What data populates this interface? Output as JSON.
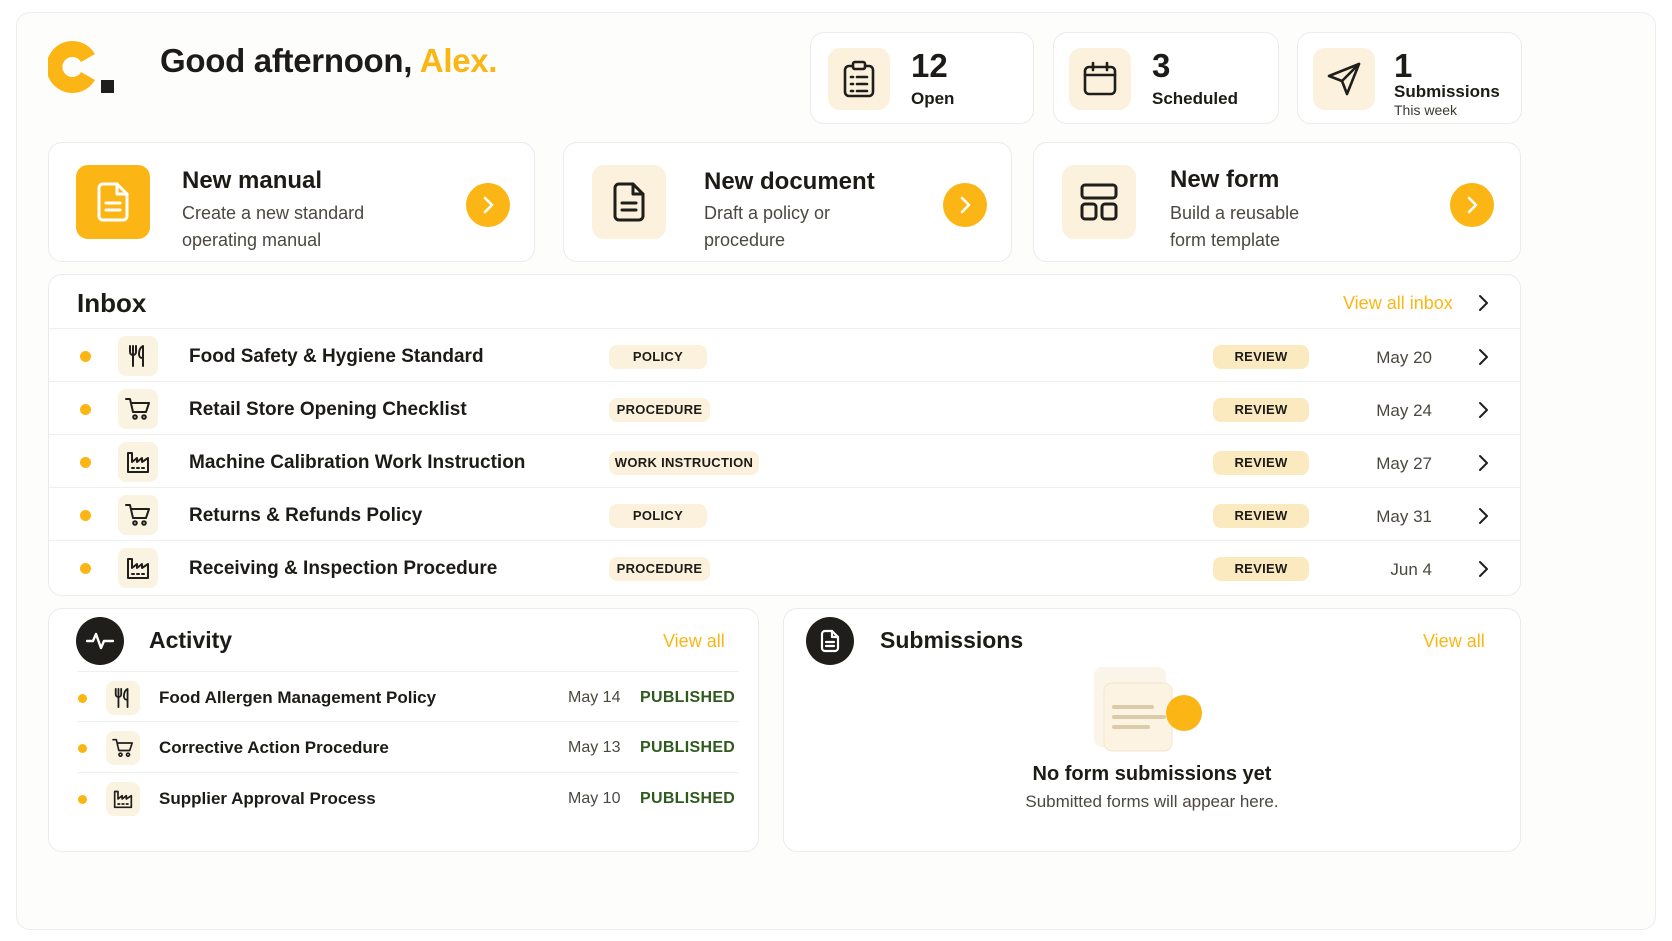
{
  "header": {
    "greeting": "Good afternoon,",
    "user_name": "Alex."
  },
  "stats": [
    {
      "value": "12",
      "label": "Open",
      "sublabel": "",
      "icon": "clipboard-icon"
    },
    {
      "value": "3",
      "label": "Scheduled",
      "sublabel": "",
      "icon": "calendar-icon"
    },
    {
      "value": "1",
      "label": "Submissions",
      "sublabel": "This week",
      "icon": "send-icon"
    }
  ],
  "quick_actions": [
    {
      "title": "New manual",
      "desc": "Create a new standard operating manual",
      "icon": "document-icon"
    },
    {
      "title": "New document",
      "desc": "Draft a policy or procedure",
      "icon": "document-icon"
    },
    {
      "title": "New form",
      "desc": "Build a reusable form template",
      "icon": "layout-icon"
    }
  ],
  "inbox": {
    "title": "Inbox",
    "view_all": "View all inbox",
    "items": [
      {
        "title": "Food Safety & Hygiene Standard",
        "tag": "POLICY",
        "status": "REVIEW",
        "date": "May 20",
        "icon": "utensils-icon"
      },
      {
        "title": "Retail Store Opening Checklist",
        "tag": "PROCEDURE",
        "status": "REVIEW",
        "date": "May 24",
        "icon": "cart-icon"
      },
      {
        "title": "Machine Calibration Work Instruction",
        "tag": "WORK INSTRUCTION",
        "status": "REVIEW",
        "date": "May 27",
        "icon": "factory-icon"
      },
      {
        "title": "Returns & Refunds Policy",
        "tag": "POLICY",
        "status": "REVIEW",
        "date": "May 31",
        "icon": "cart-icon"
      },
      {
        "title": "Receiving & Inspection Procedure",
        "tag": "PROCEDURE",
        "status": "REVIEW",
        "date": "Jun 4",
        "icon": "factory-icon"
      }
    ]
  },
  "activity": {
    "title": "Activity",
    "view_all": "View all",
    "items": [
      {
        "title": "Food Allergen Management Policy",
        "date": "May 14",
        "status": "PUBLISHED",
        "icon": "utensils-icon"
      },
      {
        "title": "Corrective Action Procedure",
        "date": "May 13",
        "status": "PUBLISHED",
        "icon": "cart-icon"
      },
      {
        "title": "Supplier Approval Process",
        "date": "May 10",
        "status": "PUBLISHED",
        "icon": "factory-icon"
      }
    ]
  },
  "submissions": {
    "title": "Submissions",
    "view_all": "View all",
    "empty_title": "No form submissions yet",
    "empty_sub": "Submitted forms will appear here."
  },
  "colors": {
    "accent": "#fbb615",
    "accent_soft": "#fbf1dc",
    "published": "#2f5a1e",
    "dark": "#1f1e1b"
  }
}
